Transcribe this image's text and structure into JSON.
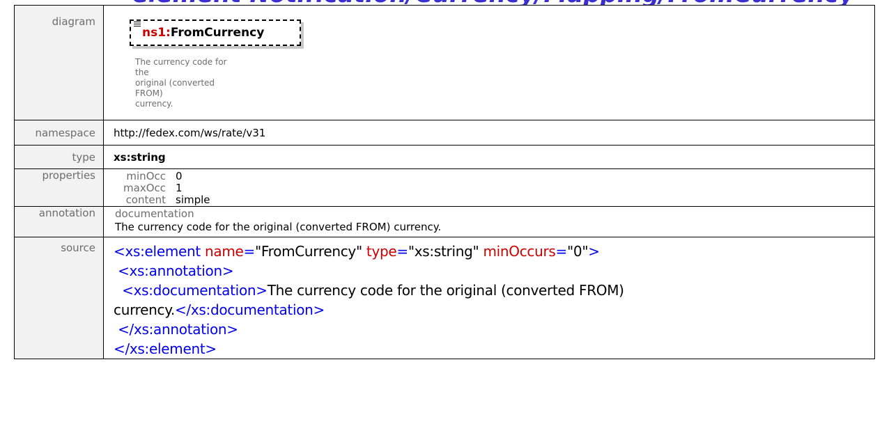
{
  "rows": {
    "diagram": {
      "label": "diagram",
      "element_prefix": "ns1:",
      "element_name": "FromCurrency",
      "doc_lines": [
        "The currency code for the",
        "original (converted FROM)",
        "currency."
      ]
    },
    "namespace": {
      "label": "namespace",
      "value": "http://fedex.com/ws/rate/v31"
    },
    "type": {
      "label": "type",
      "value": "xs:string"
    },
    "properties": {
      "label": "properties",
      "items": [
        {
          "key": "minOcc",
          "value": "0"
        },
        {
          "key": "maxOcc",
          "value": "1"
        },
        {
          "key": "content",
          "value": "simple"
        }
      ]
    },
    "annotation": {
      "label": "annotation",
      "heading": "documentation",
      "text": "The currency code for the original (converted FROM) currency."
    },
    "source": {
      "label": "source",
      "line1": {
        "tag_open": "<xs:element",
        "attr1": "name",
        "val1": "\"FromCurrency\"",
        "attr2": "type",
        "val2": "\"xs:string\"",
        "attr3": "minOccurs",
        "val3": "\"0\"",
        "close": ">"
      },
      "line2": " <xs:annotation>",
      "line3_tag": "  <xs:documentation>",
      "line3_text": "The currency code for the original (converted FROM)",
      "line4_text": "currency.",
      "line4_tag": "</xs:documentation>",
      "line5": " </xs:annotation>",
      "line6": "</xs:element>"
    }
  },
  "colors": {
    "tag": "#0000ee",
    "attr_name": "#cc0000",
    "label_bg": "#f2f2f2",
    "label_text": "#6d6d6d"
  }
}
